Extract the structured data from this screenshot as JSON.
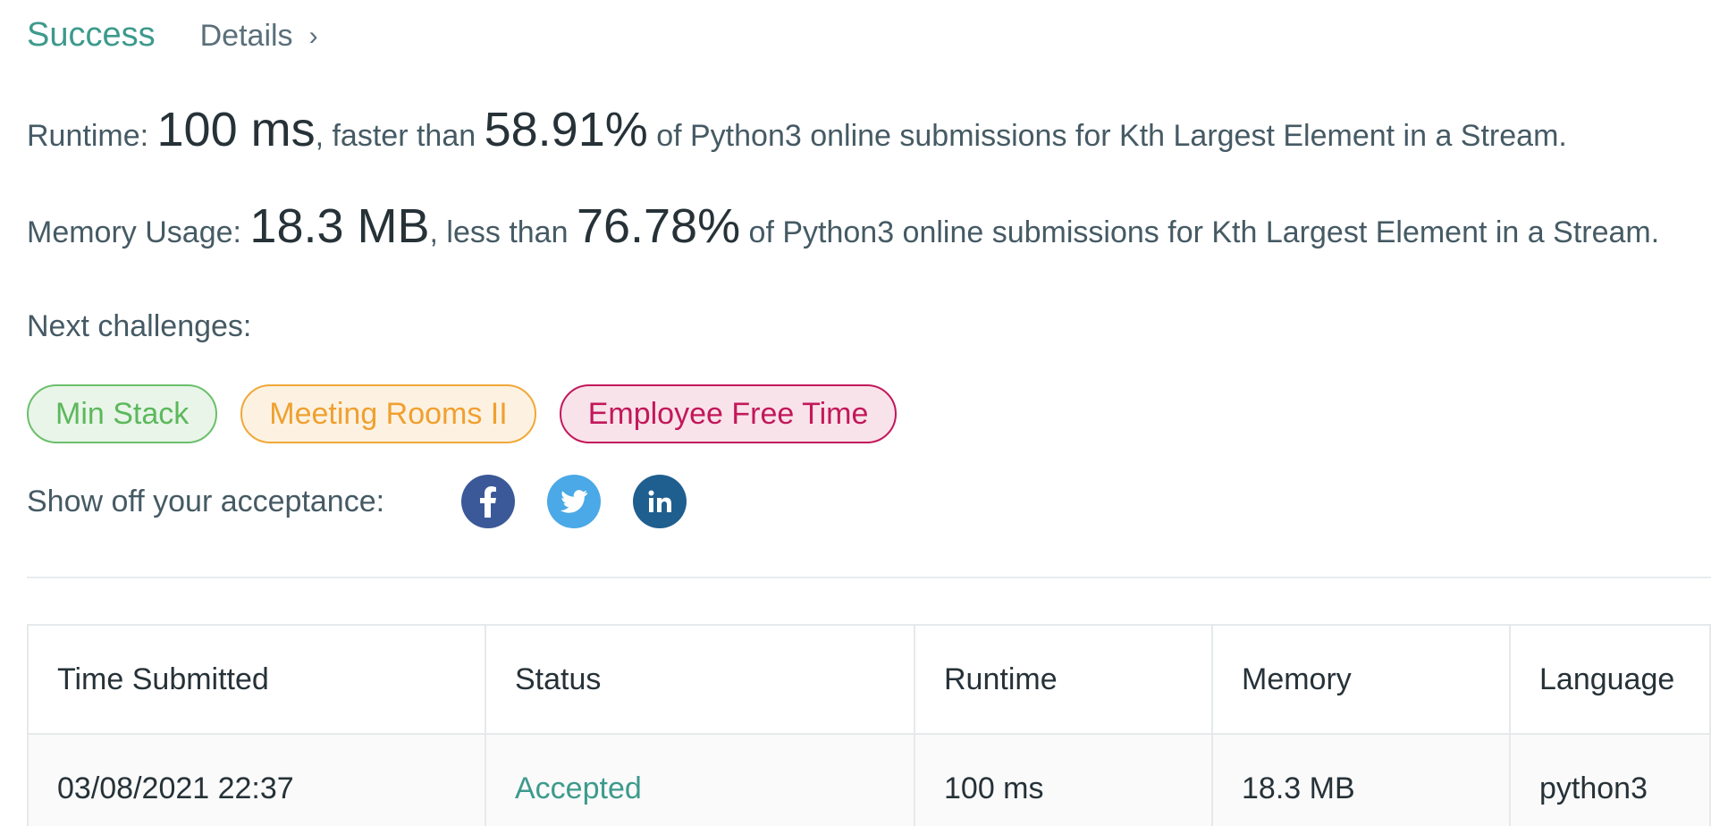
{
  "header": {
    "status": "Success",
    "details_label": "Details",
    "chevron": "›"
  },
  "runtime_line": {
    "prefix": "Runtime: ",
    "value": "100 ms",
    "middle": ", faster than ",
    "percent": "58.91%",
    "suffix": " of Python3 online submissions for Kth Largest Element in a Stream."
  },
  "memory_line": {
    "prefix": "Memory Usage: ",
    "value": "18.3 MB",
    "middle": ", less than ",
    "percent": "76.78%",
    "suffix": " of Python3 online submissions for Kth Largest Element in a Stream."
  },
  "next_challenges": {
    "label": "Next challenges:",
    "items": [
      {
        "label": "Min Stack",
        "difficulty": "easy"
      },
      {
        "label": "Meeting Rooms II",
        "difficulty": "medium"
      },
      {
        "label": "Employee Free Time",
        "difficulty": "hard"
      }
    ]
  },
  "share": {
    "label": "Show off your acceptance:",
    "icons": [
      "facebook-icon",
      "twitter-icon",
      "linkedin-icon"
    ]
  },
  "submissions_table": {
    "headers": [
      "Time Submitted",
      "Status",
      "Runtime",
      "Memory",
      "Language"
    ],
    "rows": [
      {
        "time": "03/08/2021 22:37",
        "status": "Accepted",
        "runtime": "100 ms",
        "memory": "18.3 MB",
        "language": "python3"
      }
    ]
  },
  "colors": {
    "success": "#3d9a8c",
    "easy": "#5cb85c",
    "medium": "#f0a030",
    "hard": "#c2185b",
    "facebook": "#3b5998",
    "twitter": "#4aa9e6",
    "linkedin": "#1f5f8f"
  }
}
